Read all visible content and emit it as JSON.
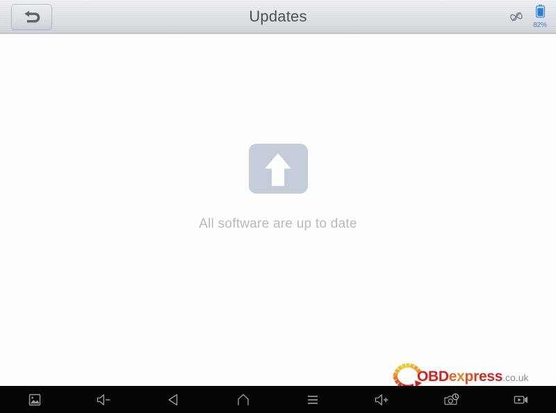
{
  "window": {
    "title": "Updates"
  },
  "titlebar": {
    "back_button": {
      "label": "",
      "icon": "back-arrow-icon"
    },
    "status": {
      "connection_icon": "unlink-icon",
      "battery_icon": "battery-icon",
      "battery_percent": "82%"
    }
  },
  "main": {
    "empty_state": {
      "icon": "software-update-arrow-icon",
      "message": "All software are up to date"
    }
  },
  "watermark": {
    "mark_icon": "circular-dashed-arrow-icon",
    "text_obd": "OBD",
    "text_e": "e",
    "text_x": "x",
    "text_p": "p",
    "text_r": "r",
    "text_e2": "e",
    "text_s": "s",
    "text_s2": "s",
    "text_tld": ".co.uk",
    "colors": {
      "obd_red": "#d81e1e",
      "express_orange": "#e8852a",
      "tld_gray": "#8c8c8c",
      "mark_yellow": "#f0c32a",
      "mark_orange": "#e8892a",
      "mark_red": "#d42020"
    }
  },
  "navbar": {
    "background": "#050505",
    "items": [
      {
        "name": "screenshot-icon",
        "label": "Screenshot"
      },
      {
        "name": "volume-down-icon",
        "label": "Volume Down"
      },
      {
        "name": "back-triangle-icon",
        "label": "Back"
      },
      {
        "name": "home-icon",
        "label": "Home"
      },
      {
        "name": "menu-icon",
        "label": "Menu"
      },
      {
        "name": "volume-up-icon",
        "label": "Volume Up"
      },
      {
        "name": "timed-screenshot-icon",
        "label": "Timed Screenshot"
      },
      {
        "name": "screen-record-icon",
        "label": "Screen Record"
      }
    ]
  },
  "theme": {
    "titlebar_top": "#eef0f3",
    "titlebar_bottom": "#c9ced6",
    "title_color": "#4b5158",
    "badge_color": "#c5cdda",
    "empty_text_color": "#b9b9b9",
    "battery_accent": "#3c7fd0"
  }
}
